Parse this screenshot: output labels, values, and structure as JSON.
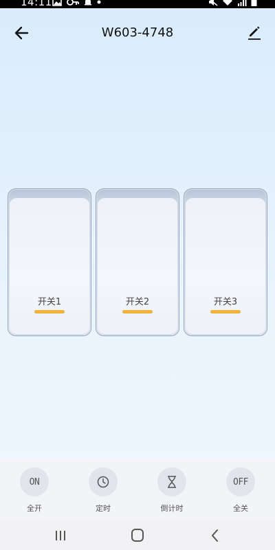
{
  "status_bar": {
    "time": "14:11",
    "left_icons": [
      "gallery-icon",
      "key-icon",
      "notification-bell-icon",
      "dot-icon"
    ],
    "right_icons": [
      "mute-icon",
      "wifi-icon",
      "signal-icon",
      "battery-icon"
    ]
  },
  "header": {
    "title": "W603-4748",
    "back_icon": "back-arrow-icon",
    "edit_icon": "edit-pencil-icon"
  },
  "switches": [
    {
      "label": "开关1",
      "indicator_color": "#f0b43a"
    },
    {
      "label": "开关2",
      "indicator_color": "#f0b43a"
    },
    {
      "label": "开关3",
      "indicator_color": "#f0b43a"
    }
  ],
  "actions": [
    {
      "icon_text": "ON",
      "label": "全开",
      "icon": "on-icon"
    },
    {
      "icon_text": "",
      "label": "定时",
      "icon": "clock-icon"
    },
    {
      "icon_text": "",
      "label": "倒计时",
      "icon": "hourglass-icon"
    },
    {
      "icon_text": "OFF",
      "label": "全关",
      "icon": "off-icon"
    }
  ],
  "nav_bar": {
    "buttons": [
      "recent-apps-icon",
      "home-icon",
      "back-icon"
    ]
  },
  "colors": {
    "accent": "#f0b43a",
    "background_top": "#d9ecfb",
    "background_bottom": "#f0f7fe"
  }
}
